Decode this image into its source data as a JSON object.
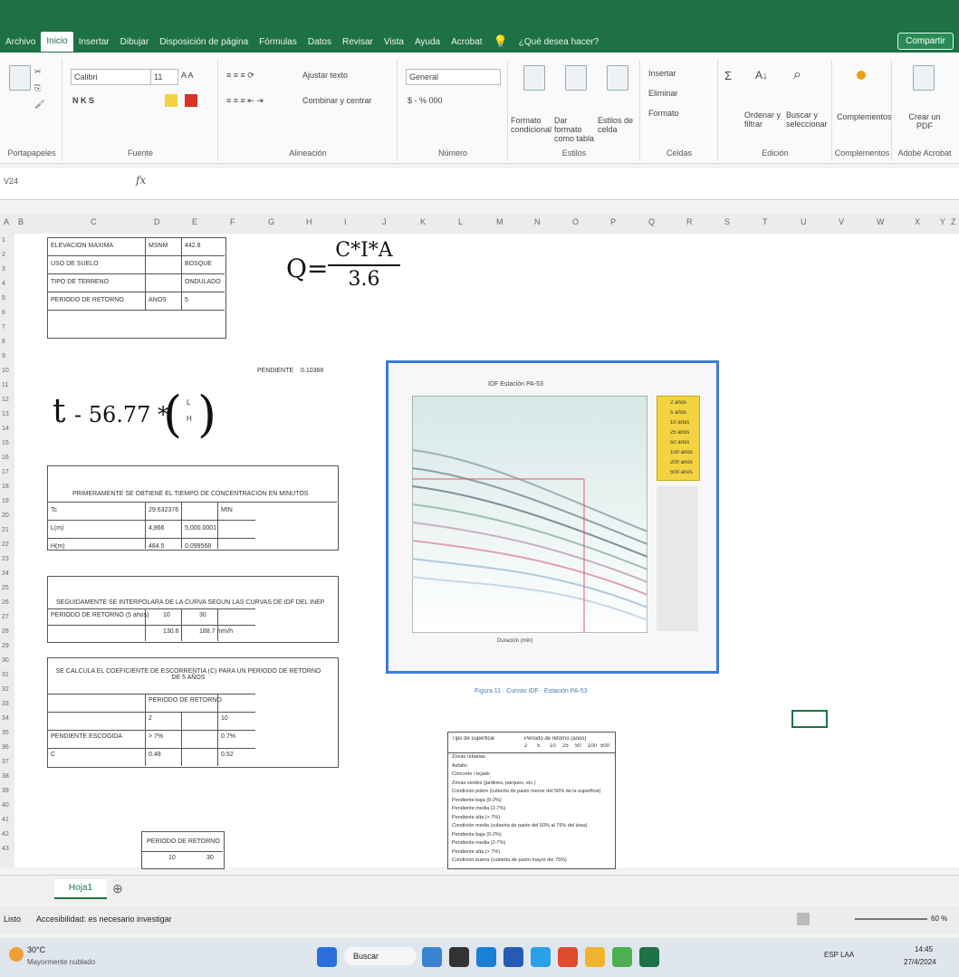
{
  "menu": {
    "tabs": [
      "Archivo",
      "Inicio",
      "Insertar",
      "Dibujar",
      "Disposición de página",
      "Fórmulas",
      "Datos",
      "Revisar",
      "Vista",
      "Ayuda",
      "Acrobat"
    ],
    "active_index": 1,
    "tell_me": "¿Qué desea hacer?",
    "share": "Compartir"
  },
  "ribbon": {
    "font_name": "Calibri",
    "font_size": "11",
    "bold_italic_underline": "N K S",
    "wrap_text": "Ajustar texto",
    "merge_center": "Combinar y centrar",
    "number_format": "General",
    "number_symbols": "$ - % 000",
    "cond_format": "Formato condicional",
    "format_table": "Dar formato como tabla",
    "cell_styles": "Estilos de celda",
    "insert": "Insertar",
    "delete": "Eliminar",
    "format": "Formato",
    "sort_filter": "Ordenar y filtrar",
    "find_select": "Buscar y seleccionar",
    "addins": "Complementos",
    "create_pdf": "Crear un PDF",
    "groups": [
      "Portapapeles",
      "Fuente",
      "Alineación",
      "Número",
      "Estilos",
      "Celdas",
      "Edición",
      "Complementos",
      "Adobe Acrobat"
    ]
  },
  "formula_bar": {
    "name_box": "V24",
    "fx": "fx",
    "content": ""
  },
  "columns": [
    "A",
    "B",
    "C",
    "D",
    "E",
    "F",
    "G",
    "H",
    "I",
    "J",
    "K",
    "L",
    "M",
    "N",
    "O",
    "P",
    "Q",
    "R",
    "S",
    "T",
    "U",
    "V",
    "W",
    "X",
    "Y",
    "Z"
  ],
  "rows": [
    "1",
    "2",
    "3",
    "4",
    "5",
    "6",
    "7",
    "8",
    "9",
    "10",
    "11",
    "12",
    "13",
    "14",
    "15",
    "16",
    "17",
    "18",
    "19",
    "20",
    "21",
    "22",
    "23",
    "24",
    "25",
    "26",
    "27",
    "28",
    "29",
    "30",
    "31",
    "32",
    "33",
    "34",
    "35",
    "36",
    "37",
    "38",
    "39",
    "40",
    "41",
    "42",
    "43"
  ],
  "sheet": {
    "top_table": [
      [
        "ELEVACIÓN MÁXIMA",
        "MSNM",
        "442.8"
      ],
      [
        "USO DE SUELO",
        "",
        "BOSQUE"
      ],
      [
        "TIPO DE TERRENO",
        "",
        "ONDULADO"
      ],
      [
        "PERIODO DE RETORNO",
        "AÑOS",
        "5"
      ]
    ],
    "pendiente_label": "PENDIENTE",
    "pendiente_value": "0.10368",
    "formula_q": {
      "lhs": "Q=",
      "num": "C*I*A",
      "den": "3.6"
    },
    "formula_t": {
      "lhs": "t",
      "eq": "- 56.77 *",
      "frac_top": "L",
      "frac_bottom": "H"
    },
    "section1": {
      "title": "PRIMERAMENTE SE OBTIENE EL TIEMPO DE CONCENTRACIÓN EN MINUTOS",
      "rows": [
        [
          "Tc",
          "29.632376",
          "MIN"
        ],
        [
          "L(m)",
          "4,866",
          "5,000.0001"
        ],
        [
          "H(m)",
          "484.5",
          "0.099568"
        ]
      ]
    },
    "section2": {
      "title": "SEGUIDAMENTE SE INTERPOLARA DE LA CURVA SEGÚN LAS CURVAS DE IDF DEL INEP",
      "rows": [
        [
          "PERIODO DE RETORNO (5 años)",
          "10",
          "30"
        ],
        [
          "",
          "130.6",
          "188.7 mm/h"
        ]
      ]
    },
    "section3": {
      "title": "SE CALCULA EL COEFICIENTE DE ESCORRENTÍA (C) PARA UN PERIODO DE RETORNO DE 5 AÑOS",
      "rows": [
        [
          "",
          "PERIODO DE RETORNO",
          ""
        ],
        [
          "",
          "2",
          "10"
        ],
        [
          "PENDIENTE ESCOGIDA",
          "> 7%",
          "0.7%"
        ],
        [
          "C",
          "0.48",
          "0.52"
        ]
      ]
    },
    "section4": {
      "title": "PERIODO DE RETORNO",
      "row": [
        "10",
        "30"
      ]
    },
    "figure_caption": "Figura 11 · Curvas IDF · Estación PA-53",
    "chart_title": "IDF Estación PA-53",
    "chart_xlabel": "Duración (min)",
    "legend": [
      "2 años",
      "5 años",
      "10 años",
      "25 años",
      "50 años",
      "100 años",
      "200 años",
      "500 años"
    ],
    "ctable": {
      "header": "Tipo de superficie",
      "subheader": "Periodo de retorno (años)",
      "years": [
        "2",
        "5",
        "10",
        "25",
        "50",
        "100",
        "500"
      ],
      "rows": [
        "Zonas urbanas",
        "Asfalto",
        "Concreto / tejado",
        "Zonas verdes (jardines, parques, etc.)",
        "Condición pobre (cubierta de pasto menor del 50% de la superficie)",
        "Pendiente baja (0-2%)",
        "Pendiente media (2-7%)",
        "Pendiente alta (> 7%)",
        "Condición media (cubierta de pasto del 50% al 75% del área)",
        "Pendiente baja (0-2%)",
        "Pendiente media (2-7%)",
        "Pendiente alta (> 7%)",
        "Condición buena (cubierta de pasto mayor del 75%)"
      ]
    }
  },
  "sheet_tab": "Hoja1",
  "status": {
    "ready": "Listo",
    "accessibility": "Accesibilidad: es necesario investigar",
    "zoom": "60 %"
  },
  "taskbar": {
    "weather_temp": "30°C",
    "weather_desc": "Mayormente nublado",
    "search": "Buscar",
    "lang": "ESP LAA",
    "time": "14:45",
    "date": "27/4/2024"
  },
  "colors": {
    "excel_green": "#1e7145",
    "legend_yellow": "#f3d33f"
  }
}
